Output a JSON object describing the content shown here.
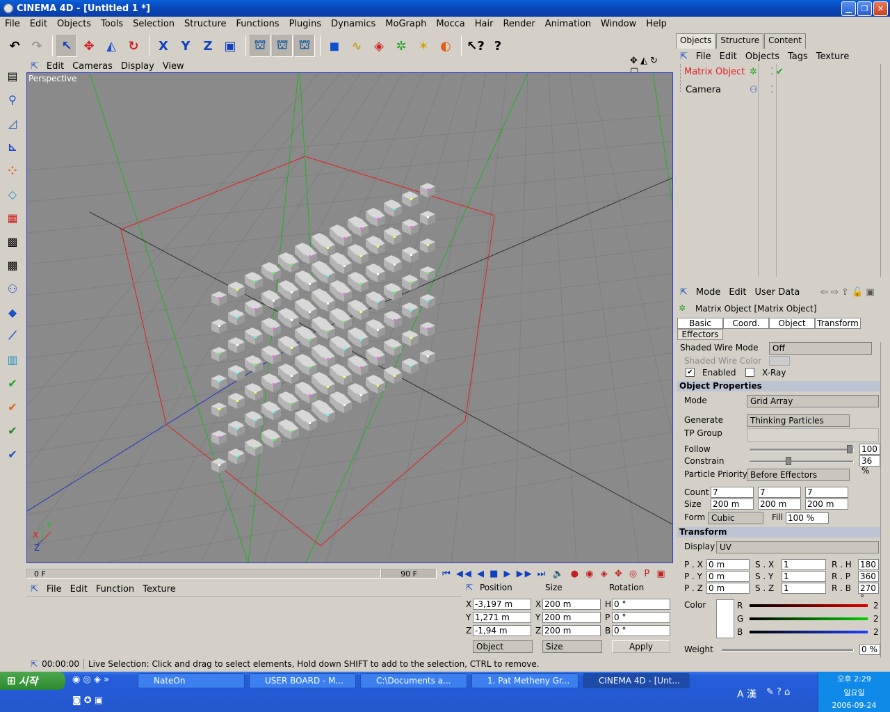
{
  "window": {
    "title": "CINEMA 4D - [Untitled 1 *]"
  },
  "menubar": [
    "File",
    "Edit",
    "Objects",
    "Tools",
    "Selection",
    "Structure",
    "Functions",
    "Plugins",
    "Dynamics",
    "MoGraph",
    "Mocca",
    "Hair",
    "Render",
    "Animation",
    "Window",
    "Help"
  ],
  "viewport": {
    "menu": [
      "Edit",
      "Cameras",
      "Display",
      "View"
    ],
    "label": "Perspective",
    "axes": {
      "x": "X",
      "y": "Y",
      "z": "Z"
    }
  },
  "timeline": {
    "start": "0 F",
    "end": "90 F"
  },
  "material_manager": {
    "menu": [
      "File",
      "Edit",
      "Function",
      "Texture"
    ]
  },
  "coordinates": {
    "headers": {
      "position": "Position",
      "size": "Size",
      "rotation": "Rotation"
    },
    "position": {
      "x": "-3,197 m",
      "y": "1,271 m",
      "z": "-1,94 m"
    },
    "size": {
      "x": "200 m",
      "y": "200 m",
      "z": "200 m"
    },
    "rotation": {
      "h": "0 °",
      "p": "0 °",
      "b": "0 °"
    },
    "mode_dropdown": "Object",
    "size_dropdown": "Size",
    "apply_label": "Apply"
  },
  "status": {
    "time": "00:00:00",
    "message": "Live Selection: Click and drag to select elements, Hold down SHIFT to add to the selection, CTRL to remove."
  },
  "object_manager": {
    "tabs": [
      "Objects",
      "Structure",
      "Content"
    ],
    "menu": [
      "File",
      "Edit",
      "Objects",
      "Tags",
      "Texture"
    ],
    "objects": [
      {
        "name": "Matrix Object",
        "selected": true
      },
      {
        "name": "Camera",
        "selected": false
      }
    ]
  },
  "attributes": {
    "menu": [
      "Mode",
      "Edit",
      "User Data"
    ],
    "object_title": "Matrix Object [Matrix Object]",
    "tabs": [
      "Basic",
      "Coord.",
      "Object",
      "Transform",
      "Effectors"
    ],
    "shaded_wire_mode_label": "Shaded Wire Mode",
    "shaded_wire_mode_value": "Off",
    "shaded_wire_color_label": "Shaded Wire Color",
    "enabled_label": "Enabled",
    "xray_label": "X-Ray",
    "section_object": "Object Properties",
    "mode_label": "Mode",
    "mode_value": "Grid Array",
    "generate_label": "Generate",
    "generate_value": "Thinking Particles",
    "tp_group_label": "TP Group",
    "follow_label": "Follow",
    "follow_value": "100 %",
    "follow_level": 0.98,
    "constrain_label": "Constrain",
    "constrain_value": "36 %",
    "constrain_level": 0.36,
    "priority_label": "Particle Priority",
    "priority_value": "Before Effectors",
    "count_label": "Count",
    "count": [
      "7",
      "7",
      "7"
    ],
    "size_label": "Size",
    "size": [
      "200 m",
      "200 m",
      "200 m"
    ],
    "form_label": "Form",
    "form_value": "Cubic",
    "fill_label": "Fill",
    "fill_value": "100 %",
    "section_transform": "Transform",
    "display_label": "Display",
    "display_value": "UV",
    "p_labels": [
      "P . X",
      "P . Y",
      "P . Z"
    ],
    "p_values": [
      "0 m",
      "0 m",
      "0 m"
    ],
    "s_labels": [
      "S . X",
      "S . Y",
      "S . Z"
    ],
    "s_values": [
      "1",
      "1",
      "1"
    ],
    "r_labels": [
      "R . H",
      "R . P",
      "R . B"
    ],
    "r_values": [
      "180 °",
      "360 °",
      "270 °"
    ],
    "color_label": "Color",
    "rgb_labels": [
      "R",
      "G",
      "B"
    ],
    "rgb_values": [
      "2",
      "2",
      "2"
    ],
    "weight_label": "Weight",
    "weight_value": "0 %"
  },
  "taskbar": {
    "start": "시작",
    "items": [
      "NateOn",
      "USER BOARD - M...",
      "C:\\Documents a...",
      "1. Pat Metheny Gr...",
      "CINEMA 4D - [Unt..."
    ],
    "tray_time": "오후 2:29",
    "tray_day": "일요일",
    "tray_date": "2006-09-24",
    "ime": "A 漢"
  }
}
